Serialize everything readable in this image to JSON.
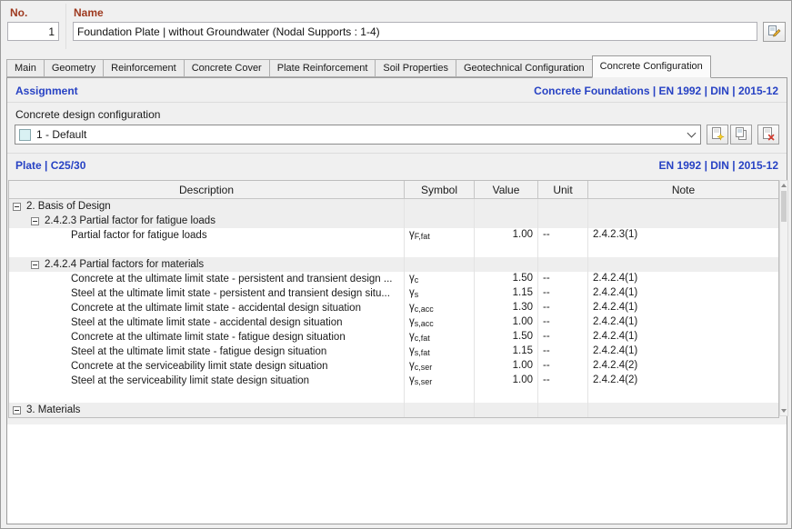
{
  "colors": {
    "accent_blue": "#2742c4",
    "label_red": "#9e3a20",
    "swatch_cyan": "#d9f1f3"
  },
  "header": {
    "no_label": "No.",
    "no_value": "1",
    "name_label": "Name",
    "name_value": "Foundation Plate | without Groundwater (Nodal Supports : 1-4)"
  },
  "tabs": [
    {
      "label": "Main",
      "active": false
    },
    {
      "label": "Geometry",
      "active": false
    },
    {
      "label": "Reinforcement",
      "active": false
    },
    {
      "label": "Concrete Cover",
      "active": false
    },
    {
      "label": "Plate Reinforcement",
      "active": false
    },
    {
      "label": "Soil Properties",
      "active": false
    },
    {
      "label": "Geotechnical Configuration",
      "active": false
    },
    {
      "label": "Concrete Configuration",
      "active": true
    }
  ],
  "assignment": {
    "title": "Assignment",
    "standard": "Concrete Foundations | EN 1992 | DIN | 2015-12",
    "config_label": "Concrete design configuration",
    "config_value": "1 - Default"
  },
  "subtitle": {
    "left": "Plate | C25/30",
    "right": "EN 1992 | DIN | 2015-12"
  },
  "table": {
    "columns": [
      "Description",
      "Symbol",
      "Value",
      "Unit",
      "Note"
    ],
    "rows": [
      {
        "type": "group",
        "level": 0,
        "text": "2. Basis of Design"
      },
      {
        "type": "group",
        "level": 1,
        "text": "2.4.2.3 Partial factor for fatigue loads"
      },
      {
        "type": "data",
        "desc": "Partial factor for fatigue loads",
        "sym": "γ",
        "sub": "F,fat",
        "value": "1.00",
        "unit": "--",
        "note": "2.4.2.3(1)"
      },
      {
        "type": "spacer"
      },
      {
        "type": "group",
        "level": 1,
        "text": "2.4.2.4 Partial factors for materials"
      },
      {
        "type": "data",
        "desc": "Concrete at the ultimate limit state - persistent and transient design ...",
        "sym": "γ",
        "sub": "c",
        "value": "1.50",
        "unit": "--",
        "note": "2.4.2.4(1)"
      },
      {
        "type": "data",
        "desc": "Steel at the ultimate limit state - persistent and transient design situ...",
        "sym": "γ",
        "sub": "s",
        "value": "1.15",
        "unit": "--",
        "note": "2.4.2.4(1)"
      },
      {
        "type": "data",
        "desc": "Concrete at the ultimate limit state - accidental design situation",
        "sym": "γ",
        "sub": "c,acc",
        "value": "1.30",
        "unit": "--",
        "note": "2.4.2.4(1)"
      },
      {
        "type": "data",
        "desc": "Steel at the ultimate limit state - accidental design situation",
        "sym": "γ",
        "sub": "s,acc",
        "value": "1.00",
        "unit": "--",
        "note": "2.4.2.4(1)"
      },
      {
        "type": "data",
        "desc": "Concrete at the ultimate limit state - fatigue design situation",
        "sym": "γ",
        "sub": "c,fat",
        "value": "1.50",
        "unit": "--",
        "note": "2.4.2.4(1)"
      },
      {
        "type": "data",
        "desc": "Steel at the ultimate limit state - fatigue design situation",
        "sym": "γ",
        "sub": "s,fat",
        "value": "1.15",
        "unit": "--",
        "note": "2.4.2.4(1)"
      },
      {
        "type": "data",
        "desc": "Concrete at the serviceability limit state design situation",
        "sym": "γ",
        "sub": "c,ser",
        "value": "1.00",
        "unit": "--",
        "note": "2.4.2.4(2)"
      },
      {
        "type": "data",
        "desc": "Steel at the serviceability limit state design situation",
        "sym": "γ",
        "sub": "s,ser",
        "value": "1.00",
        "unit": "--",
        "note": "2.4.2.4(2)"
      },
      {
        "type": "spacer"
      },
      {
        "type": "group",
        "level": 0,
        "text": "3. Materials"
      }
    ]
  }
}
